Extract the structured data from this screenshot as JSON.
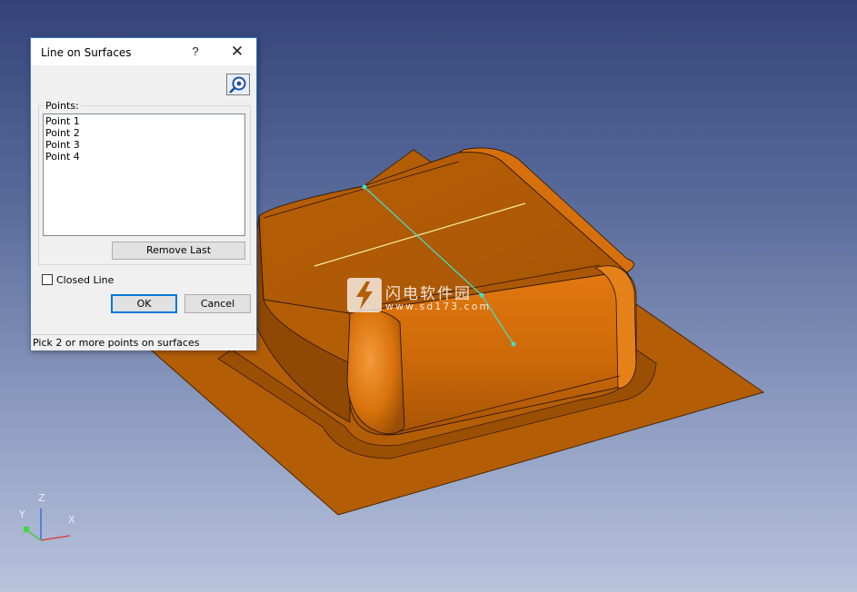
{
  "dialog": {
    "title": "Line on Surfaces",
    "help_glyph": "?",
    "close_glyph": "✕",
    "points_label": "Points:",
    "points": [
      "Point 1",
      "Point 2",
      "Point 3",
      "Point 4"
    ],
    "remove_last_label": "Remove Last",
    "closed_line_label": "Closed Line",
    "closed_line_checked": false,
    "ok_label": "OK",
    "cancel_label": "Cancel",
    "status": "Pick 2 or more points on surfaces",
    "pick_icon": "pick-point-icon"
  },
  "triad": {
    "z": "Z",
    "y": "Y",
    "x": "X"
  },
  "watermark": {
    "text": "闪电软件园",
    "url": "www.sd173.com"
  },
  "colors": {
    "part_face": "#b35e07",
    "part_light": "#e67e14",
    "part_dark": "#8c4a05",
    "selection_line": "#40e0d0",
    "highlight_line": "#f5f0a0",
    "dialog_accent": "#0078d7"
  }
}
